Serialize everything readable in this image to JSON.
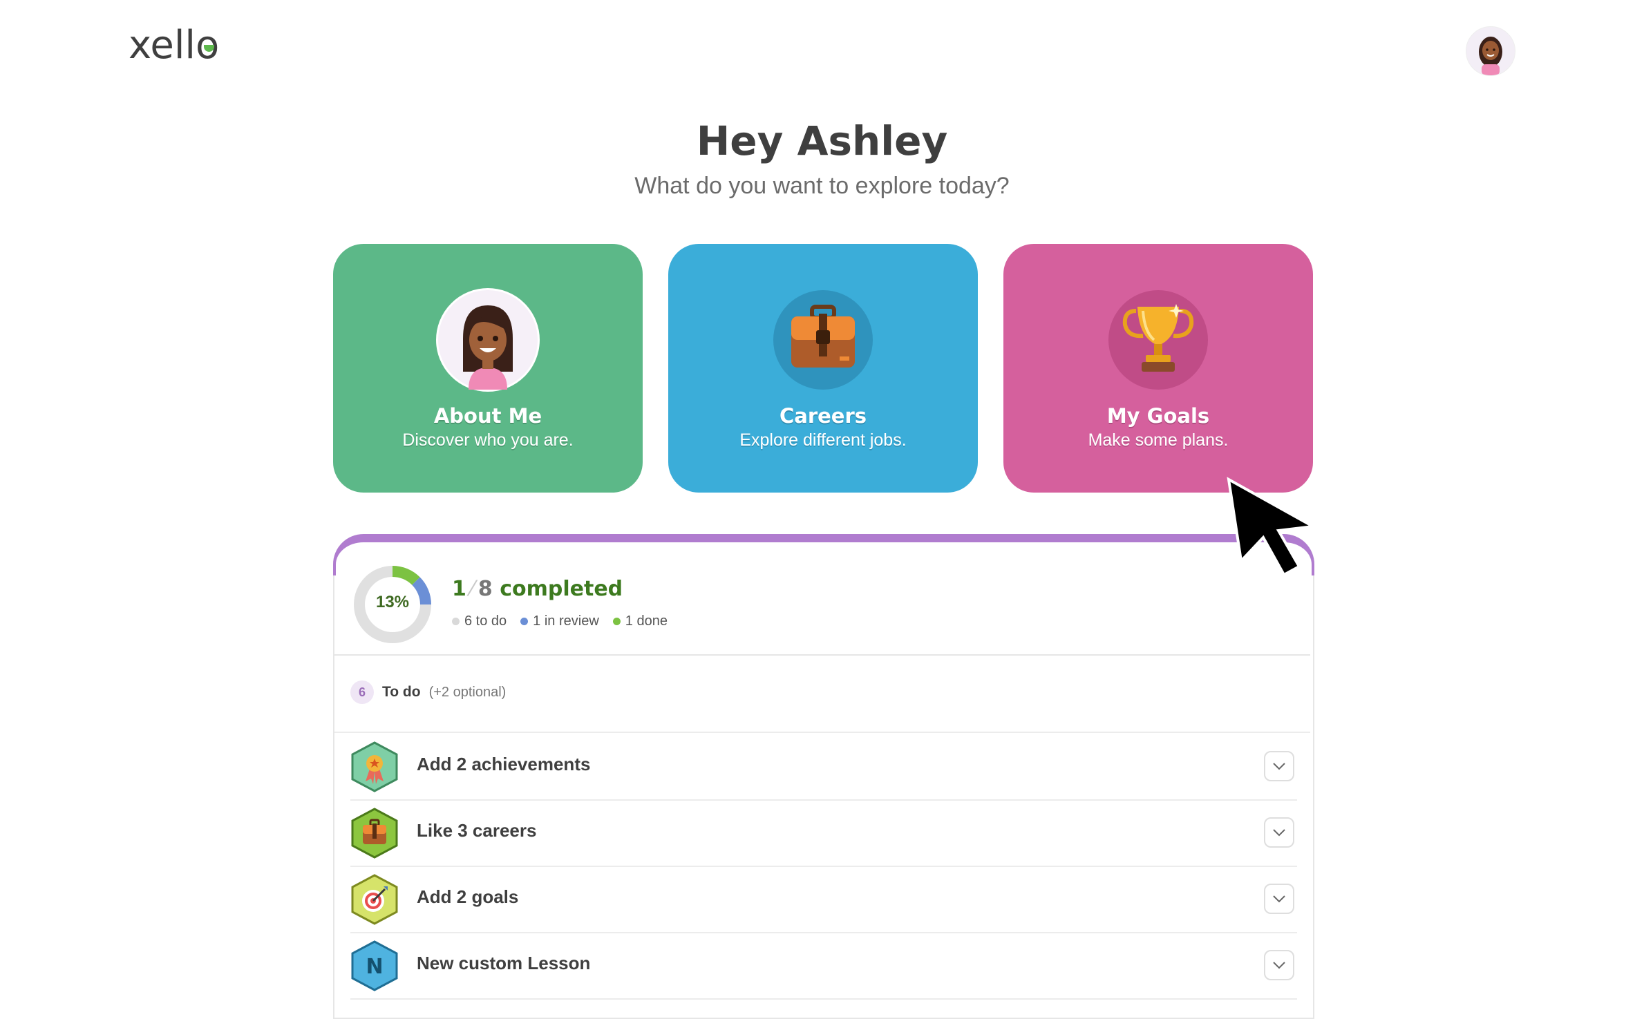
{
  "header": {
    "logo_text": "xell",
    "logo_last": "o"
  },
  "greeting": {
    "title": "Hey Ashley",
    "subtitle": "What do you want to explore today?"
  },
  "cards": [
    {
      "title": "About Me",
      "description": "Discover who you are.",
      "icon": "avatar-icon",
      "color": "#5cb888"
    },
    {
      "title": "Careers",
      "description": "Explore different jobs.",
      "icon": "briefcase-icon",
      "color": "#3badd9"
    },
    {
      "title": "My Goals",
      "description": "Make some plans.",
      "icon": "trophy-icon",
      "color": "#d5609d"
    }
  ],
  "progress": {
    "percent_label": "13%",
    "completed": "1",
    "total": "8",
    "completed_word": "completed",
    "legend": [
      {
        "label": "6 to do",
        "color": "#d9d9d9"
      },
      {
        "label": "1 in review",
        "color": "#6b8fd6"
      },
      {
        "label": "1 done",
        "color": "#7cc242"
      }
    ],
    "done_fraction": 0.125,
    "review_fraction": 0.125
  },
  "todo": {
    "count": "6",
    "title": "To do",
    "optional": "(+2 optional)",
    "tasks": [
      {
        "label": "Add 2 achievements",
        "icon": "ribbon-icon"
      },
      {
        "label": "Like 3 careers",
        "icon": "briefcase-icon"
      },
      {
        "label": "Add 2 goals",
        "icon": "target-icon"
      },
      {
        "label": "New custom Lesson",
        "icon": "lesson-icon"
      }
    ]
  }
}
